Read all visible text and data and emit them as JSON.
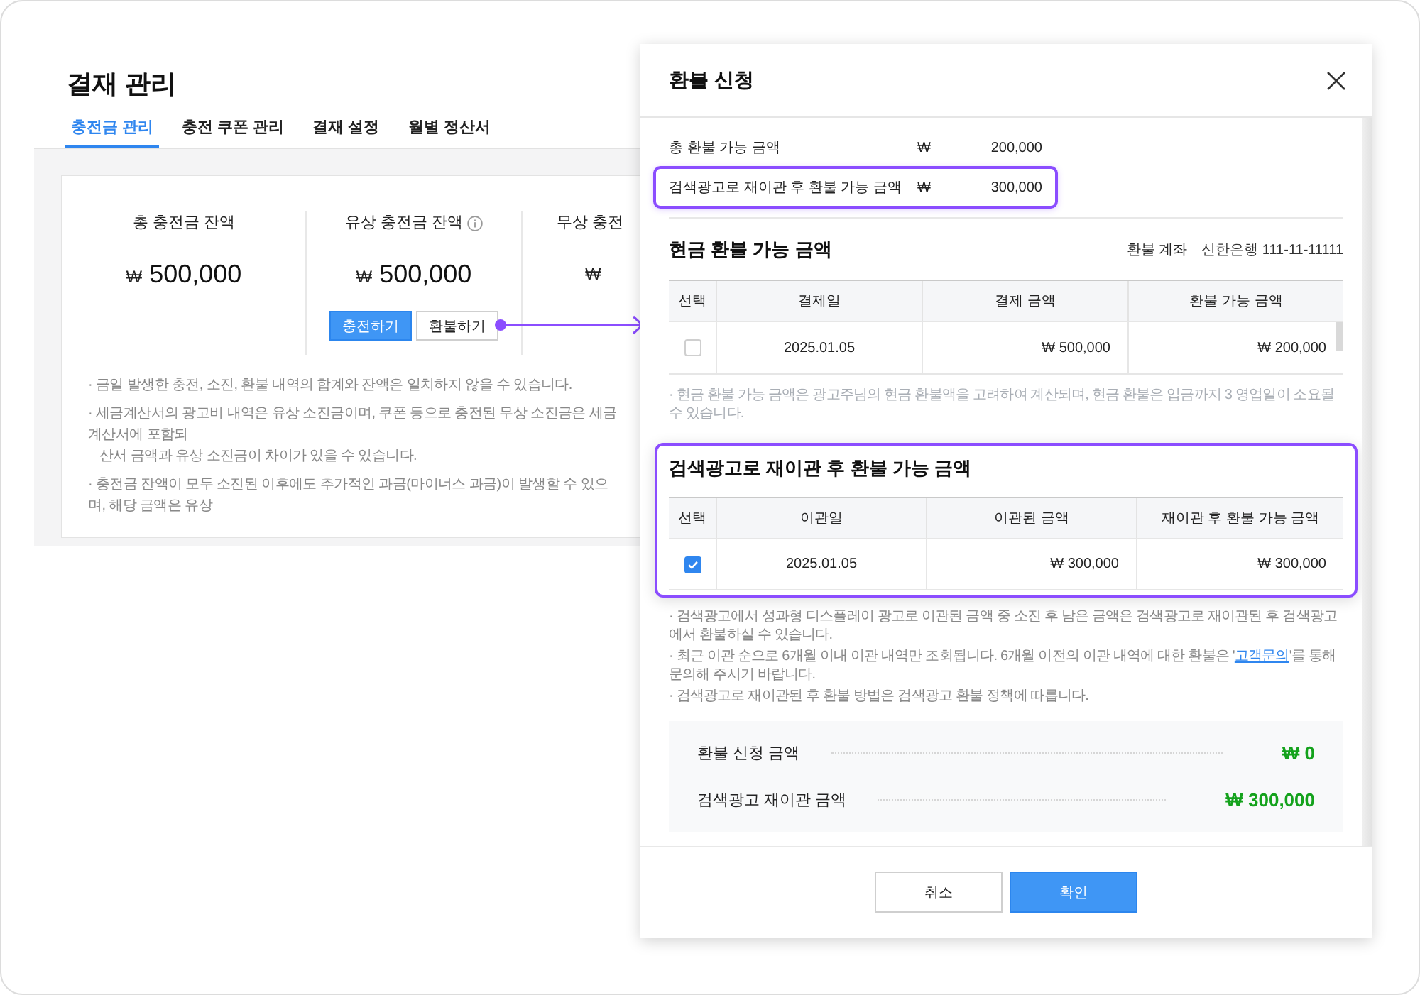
{
  "page": {
    "title": "결재 관리",
    "tabs": [
      {
        "label": "충전금 관리",
        "selected": true
      },
      {
        "label": "충전 쿠폰 관리",
        "selected": false
      },
      {
        "label": "결재 설정",
        "selected": false
      },
      {
        "label": "월별 정산서",
        "selected": false
      }
    ],
    "stats": [
      {
        "label": "총 충전금 잔액",
        "info": false,
        "currency": "₩",
        "amount": "500,000"
      },
      {
        "label": "유상 충전금 잔액",
        "info": true,
        "currency": "₩",
        "amount": "500,000",
        "actions": [
          {
            "label": "충전하기",
            "kind": "primary"
          },
          {
            "label": "환불하기",
            "kind": "secondary"
          }
        ]
      },
      {
        "label": "무상 충전",
        "info": false,
        "currency": "₩"
      }
    ],
    "notes": [
      {
        "lines": [
          "· 금일 발생한 충전, 소진, 환불 내역의 합계와 잔액은 일치하지 않을 수 있습니다."
        ]
      },
      {
        "lines": [
          "· 세금계산서의 광고비 내역은 유상 소진금이며, 쿠폰 등으로 충전된 무상 소진금은 세금계산서에 포함되",
          "산서 금액과 유상 소진금이 차이가 있을 수 있습니다."
        ]
      },
      {
        "lines": [
          "· 충전금 잔액이 모두 소진된 이후에도 추가적인 과금(마이너스 과금)이 발생할 수 있으며, 해당 금액은 유상"
        ]
      }
    ]
  },
  "modal": {
    "title": "환불 신청",
    "summary_rows": [
      {
        "label": "총 환불 가능 금액",
        "currency": "₩",
        "amount": "200,000",
        "highlighted": false
      },
      {
        "label": "검색광고로 재이관 후 환불 가능 금액",
        "currency": "₩",
        "amount": "300,000",
        "highlighted": true
      }
    ],
    "cash_refund": {
      "title": "현금 환불 가능 금액",
      "account_label": "환불 계좌",
      "account": "신한은행 111-11-11111",
      "table": {
        "select_label": "선택",
        "columns": [
          "결제일",
          "결제 금액",
          "환불 가능 금액"
        ],
        "rows": [
          {
            "checked": false,
            "cells": [
              "2025.01.05",
              "₩ 500,000",
              "₩ 200,000"
            ]
          }
        ]
      },
      "note": "· 현금 환불 가능 금액은 광고주님의 현금 환불액을 고려하여 계산되며, 현금 환불은 입금까지 3 영업일이 소요될 수 있습니다."
    },
    "transfer_refund": {
      "title": "검색광고로 재이관 후 환불 가능 금액",
      "highlighted": true,
      "table": {
        "select_label": "선택",
        "columns": [
          "이관일",
          "이관된 금액",
          "재이관 후 환불 가능 금액"
        ],
        "rows": [
          {
            "checked": true,
            "cells": [
              "2025.01.05",
              "₩ 300,000",
              "₩ 300,000"
            ]
          }
        ]
      }
    },
    "notes": [
      {
        "text": "· 검색광고에서 성과형 디스플레이 광고로 이관된 금액 중 소진 후 남은 금액은 검색광고로 재이관된 후 검색광고에서 환불하실 수 있습니다."
      },
      {
        "text": "· 최근 이관 순으로 6개월 이내 이관 내역만 조회됩니다. 6개월 이전의 이관 내역에 대한 환불은 '",
        "link": "고객문의",
        "text_after": "'를 통해 문의해 주시기 바랍니다."
      },
      {
        "text": "· 검색광고로 재이관된 후 환불 방법은 검색광고 환불 정책에 따릅니다."
      }
    ],
    "totals": [
      {
        "label": "환불 신청 금액",
        "value": "₩ 0"
      },
      {
        "label": "검색광고 재이관 금액",
        "value": "₩ 300,000"
      }
    ],
    "buttons": [
      {
        "label": "취소",
        "kind": "secondary"
      },
      {
        "label": "확인",
        "kind": "primary"
      }
    ]
  }
}
